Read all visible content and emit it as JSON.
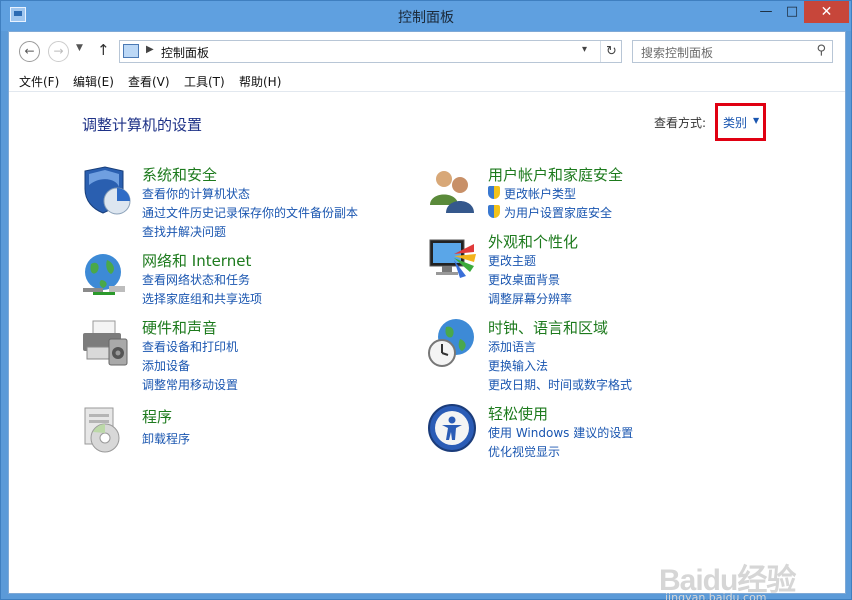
{
  "window": {
    "title": "控制面板",
    "min": "—",
    "max": "□",
    "close": "✕"
  },
  "address": {
    "path": "控制面板",
    "search_placeholder": "搜索控制面板"
  },
  "menu": [
    "文件(F)",
    "编辑(E)",
    "查看(V)",
    "工具(T)",
    "帮助(H)"
  ],
  "main": {
    "heading": "调整计算机的设置",
    "view_by_label": "查看方式:",
    "view_by_value": "类别"
  },
  "categories": {
    "left": [
      {
        "title": "系统和安全",
        "links": [
          "查看你的计算机状态",
          "通过文件历史记录保存你的文件备份副本",
          "查找并解决问题"
        ]
      },
      {
        "title": "网络和 Internet",
        "links": [
          "查看网络状态和任务",
          "选择家庭组和共享选项"
        ]
      },
      {
        "title": "硬件和声音",
        "links": [
          "查看设备和打印机",
          "添加设备",
          "调整常用移动设置"
        ]
      },
      {
        "title": "程序",
        "links": [
          "卸载程序"
        ]
      }
    ],
    "right": [
      {
        "title": "用户帐户和家庭安全",
        "links": [
          "更改帐户类型",
          "为用户设置家庭安全"
        ]
      },
      {
        "title": "外观和个性化",
        "links": [
          "更改主题",
          "更改桌面背景",
          "调整屏幕分辨率"
        ]
      },
      {
        "title": "时钟、语言和区域",
        "links": [
          "添加语言",
          "更换输入法",
          "更改日期、时间或数字格式"
        ]
      },
      {
        "title": "轻松使用",
        "links": [
          "使用 Windows 建议的设置",
          "优化视觉显示"
        ]
      }
    ]
  },
  "watermark": {
    "logo": "Baidu经验",
    "url": "jingyan.baidu.com"
  },
  "colors": {
    "accent": "#1a56b0",
    "category": "#1d7a1d",
    "highlight": "#e00012"
  }
}
